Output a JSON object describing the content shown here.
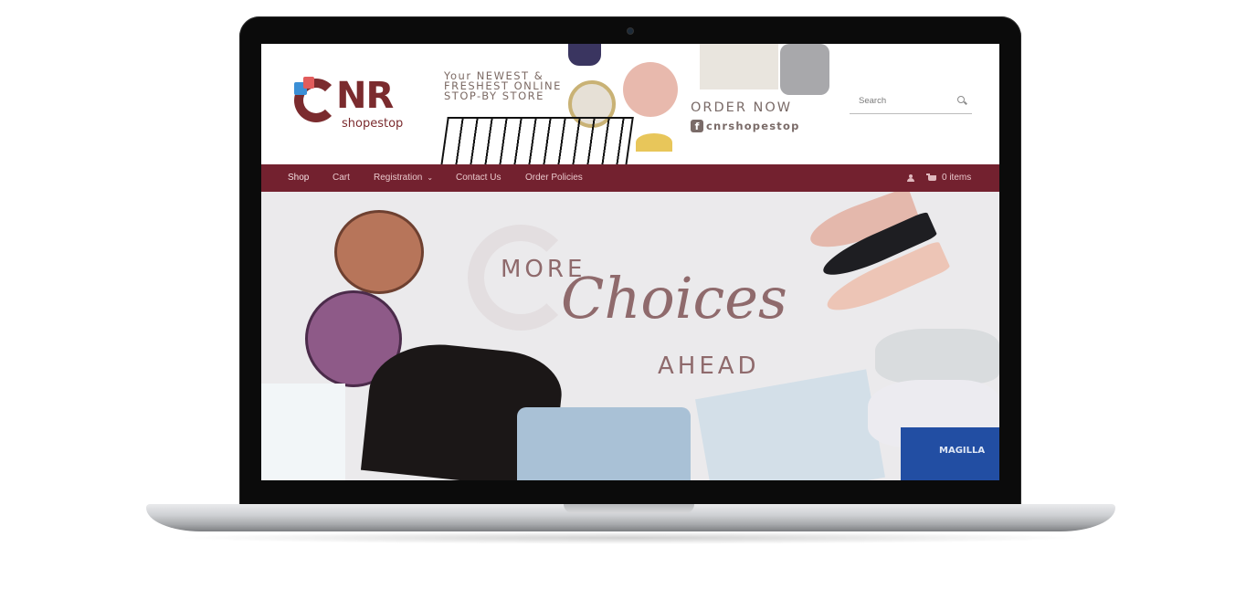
{
  "header": {
    "logo": {
      "main": "NR",
      "sub": "shopestop"
    },
    "banner": {
      "tagline": "Your NEWEST &\nFRESHEST ONLINE\nSTOP-BY STORE",
      "cta": "ORDER NOW",
      "social_handle": "cnrshopestop",
      "social_icon": "facebook-icon"
    },
    "search": {
      "placeholder": "Search",
      "icon": "search-icon"
    }
  },
  "nav": {
    "items": [
      {
        "label": "Shop"
      },
      {
        "label": "Cart"
      },
      {
        "label": "Registration",
        "dropdown": true
      },
      {
        "label": "Contact Us"
      },
      {
        "label": "Order Policies"
      }
    ],
    "account_icon": "user-icon",
    "cart_icon": "cart-icon",
    "cart_count": "0 items"
  },
  "hero": {
    "line1": "MORE",
    "script": "Choices",
    "line2": "AHEAD",
    "shirt_text": "MAGILLA"
  },
  "colors": {
    "brand": "#7b2b2e",
    "nav_background": "#73212f",
    "hero_text": "#8f6a6c"
  }
}
